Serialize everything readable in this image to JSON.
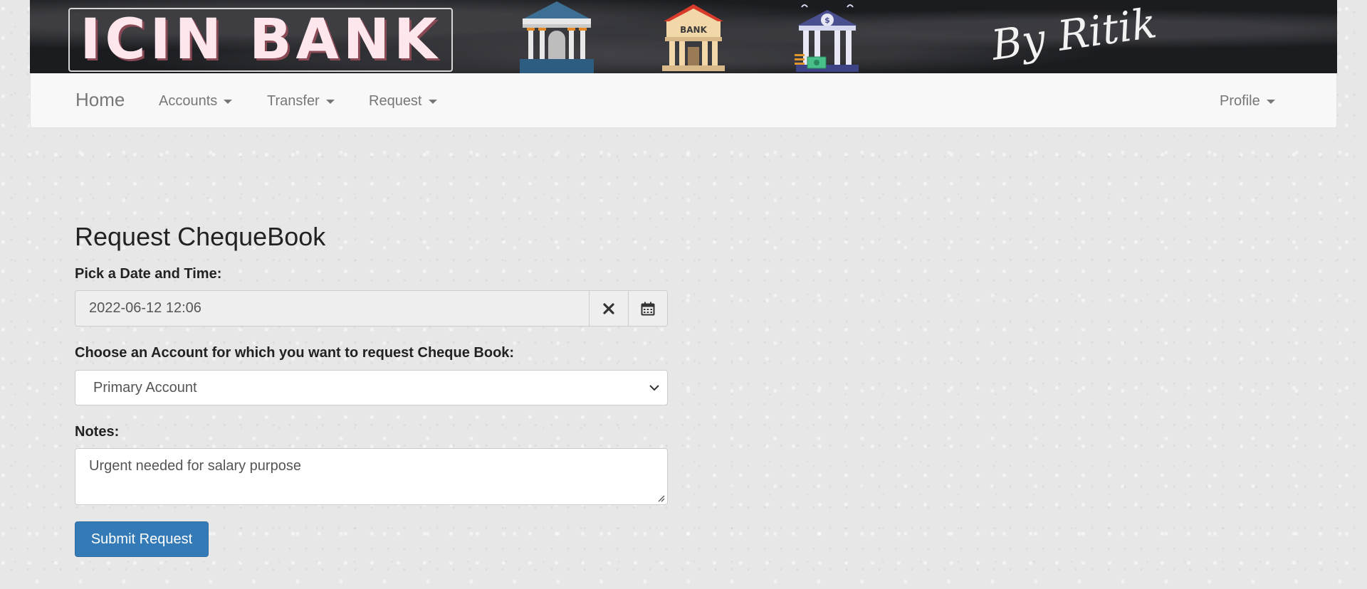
{
  "banner": {
    "logo_text": "ICIN BANK",
    "bank_sign_text": "BANK",
    "signature_text": "By Ritik"
  },
  "navbar": {
    "brand": "Home",
    "items": [
      {
        "label": "Accounts",
        "icon": "caret-down-icon"
      },
      {
        "label": "Transfer",
        "icon": "caret-down-icon"
      },
      {
        "label": "Request",
        "icon": "caret-down-icon"
      }
    ],
    "profile": {
      "label": "Profile",
      "icon": "caret-down-icon"
    }
  },
  "form": {
    "title": "Request ChequeBook",
    "date_label": "Pick a Date and Time:",
    "date_value": "2022-06-12 12:06",
    "clear_icon": "close-icon",
    "calendar_icon": "calendar-icon",
    "account_label": "Choose an Account for which you want to request Cheque Book:",
    "account_selected": "Primary Account",
    "notes_label": "Notes:",
    "notes_value": "Urgent needed for salary purpose",
    "submit_label": "Submit Request"
  },
  "colors": {
    "primary_button": "#337ab7",
    "navbar_bg": "#f8f8f8",
    "banner_bg": "#1b1c20",
    "logo_text": "#fde7ec"
  }
}
